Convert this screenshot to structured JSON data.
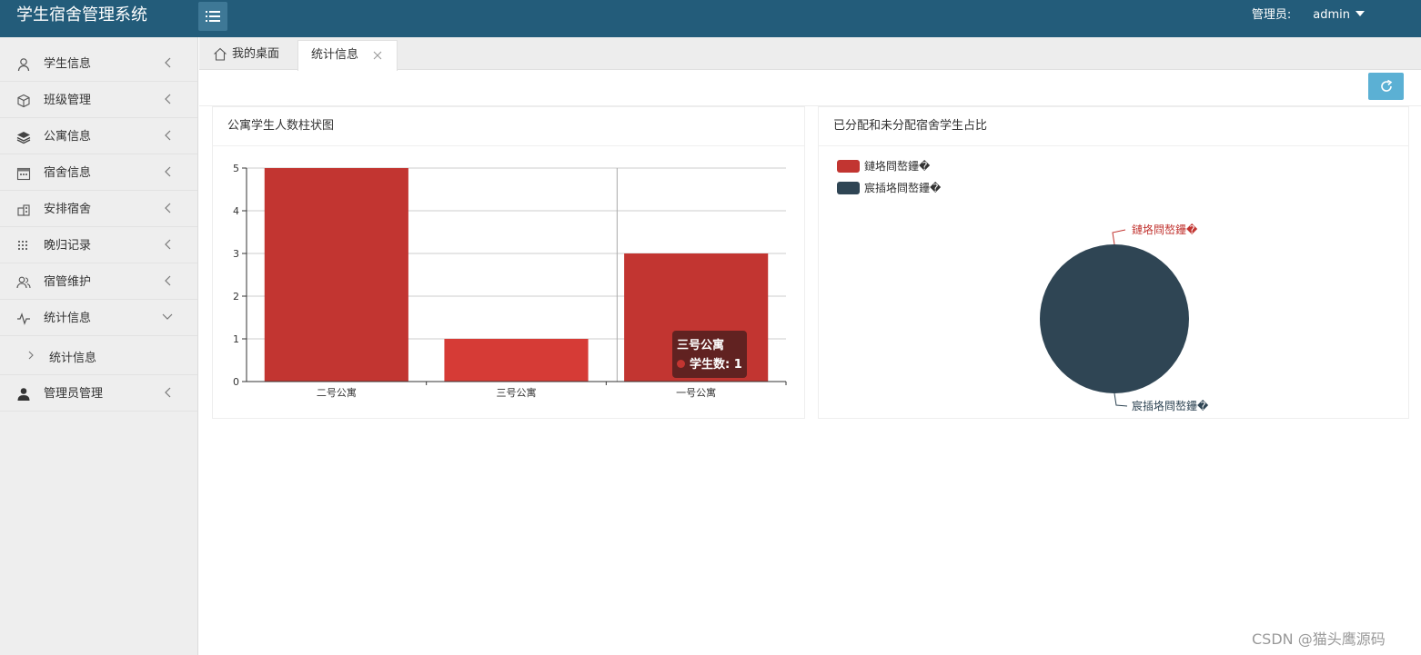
{
  "header": {
    "app_title": "学生宿舍管理系统",
    "admin_label": "管理员:",
    "username": "admin"
  },
  "sidebar": {
    "items": [
      {
        "label": "学生信息",
        "icon": "user-icon"
      },
      {
        "label": "班级管理",
        "icon": "cube-icon"
      },
      {
        "label": "公寓信息",
        "icon": "layers-icon"
      },
      {
        "label": "宿舍信息",
        "icon": "calendar-icon"
      },
      {
        "label": "安排宿舍",
        "icon": "building-icon"
      },
      {
        "label": "晚归记录",
        "icon": "grid-icon"
      },
      {
        "label": "宿管维护",
        "icon": "users-icon"
      },
      {
        "label": "统计信息",
        "icon": "pulse-icon",
        "expanded": true
      },
      {
        "label": "管理员管理",
        "icon": "person-solid-icon"
      }
    ],
    "subitems": [
      {
        "label": "统计信息"
      }
    ]
  },
  "tabs": [
    {
      "label": "我的桌面",
      "icon": "home-icon"
    },
    {
      "label": "统计信息",
      "active": true
    }
  ],
  "bar_panel": {
    "title": "公寓学生人数柱状图",
    "tooltip": {
      "title": "三号公寓",
      "series": "学生数",
      "value": "1"
    }
  },
  "pie_panel": {
    "title": "已分配和未分配宿舍学生占比",
    "legend": [
      "鏈垎閰嶅鑸�",
      "宸插垎閰嶅鑸�"
    ],
    "labels": [
      "鏈垎閰嶅鑸�",
      "宸插垎閰嶅鑸�"
    ]
  },
  "colors": {
    "header_bg": "#235c7a",
    "bar": "#c23531",
    "bar_hover": "#d63b36",
    "pie_dark": "#2f4554",
    "refresh_btn": "#5bb0d4"
  },
  "chart_data": [
    {
      "type": "bar",
      "title": "公寓学生人数柱状图",
      "categories": [
        "二号公寓",
        "三号公寓",
        "一号公寓"
      ],
      "series": [
        {
          "name": "学生数",
          "values": [
            5,
            1,
            3
          ]
        }
      ],
      "ylim": [
        0,
        5
      ],
      "yticks": [
        0,
        1,
        2,
        3,
        4,
        5
      ],
      "grid": true
    },
    {
      "type": "pie",
      "title": "已分配和未分配宿舍学生占比",
      "categories": [
        "鏈垎閰嶅鑸�",
        "宸插垎閰嶅鑸�"
      ],
      "values": [
        0,
        1
      ],
      "legend": "top-left"
    }
  ],
  "watermark": "CSDN @猫头鹰源码"
}
